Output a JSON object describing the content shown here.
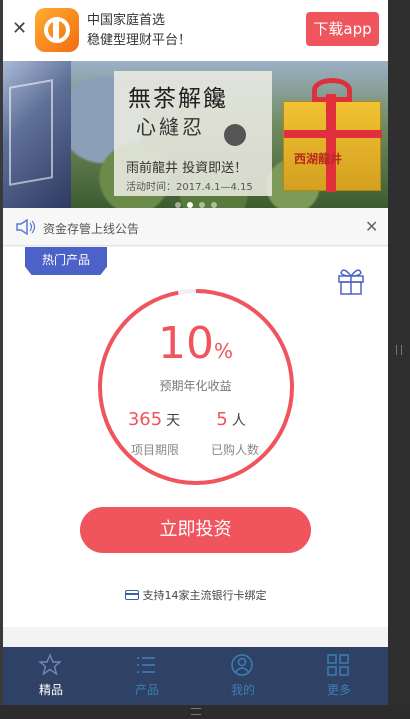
{
  "download_bar": {
    "title_line1": "中国家庭首选",
    "title_line2": "稳健型理财平台！",
    "download_label": "下载app"
  },
  "banner": {
    "headline": "無茶解饞",
    "subline": "心縫忍",
    "promo": "雨前龍井 投資即送！",
    "activity_time": "活动时间：2017.4.1—4.15",
    "box_label": "西湖龍井",
    "slide_count": 4,
    "active_slide": 1
  },
  "notice": {
    "text": "资金存管上线公告"
  },
  "product": {
    "tag": "热门产品",
    "rate_value": "10",
    "rate_unit": "%",
    "rate_label": "预期年化收益",
    "term_value": "365",
    "term_unit": "天",
    "term_label": "项目期限",
    "buyers_value": "5",
    "buyers_unit": "人",
    "buyers_label": "已购人数",
    "progress": 0.97,
    "invest_label": "立即投资",
    "bank_note": "支持14家主流银行卡绑定"
  },
  "tabs": [
    {
      "label": "精品",
      "icon": "star-icon",
      "active": true
    },
    {
      "label": "产品",
      "icon": "list-icon",
      "active": false
    },
    {
      "label": "我的",
      "icon": "user-icon",
      "active": false
    },
    {
      "label": "更多",
      "icon": "grid-icon",
      "active": false
    }
  ],
  "colors": {
    "accent": "#f0545d",
    "tab_bar": "#2f4164",
    "tab_inactive": "#3a7fb8",
    "tag": "#4c62c8"
  }
}
